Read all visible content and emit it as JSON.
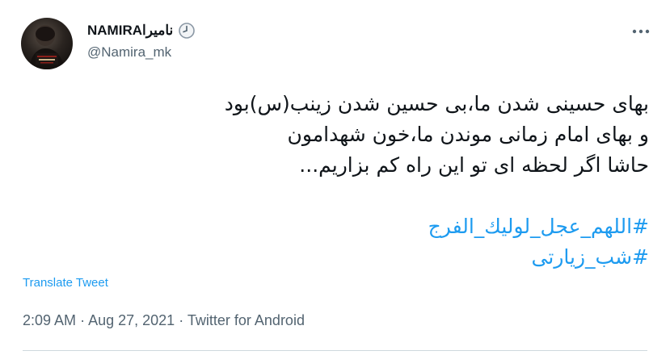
{
  "user": {
    "display_name": "NAMIRAنامیرا",
    "handle": "@Namira_mk",
    "avatar_icon": "profile-avatar",
    "status_icon": "clock-icon"
  },
  "menu": {
    "icon": "more-horizontal-icon"
  },
  "tweet": {
    "lines": [
      "بهای حسینی شدن ما،بی حسین شدن زینب(س)بود",
      "و بهای امام زمانی موندن ما،خون شهدامون",
      "حاشا اگر لحظه ای تو این راه کم بزاریم..."
    ],
    "hashtags": [
      "#اللهم_عجل_لوليك_الفرج",
      "#شب_زیارتی"
    ]
  },
  "translate_label": "Translate Tweet",
  "meta": {
    "time": "2:09 AM",
    "separator": "·",
    "date": "Aug 27, 2021",
    "source": "Twitter for Android"
  },
  "colors": {
    "link": "#1d9bf0",
    "secondary_text": "#536471",
    "primary_text": "#0f1419",
    "divider": "#cfd9de"
  }
}
